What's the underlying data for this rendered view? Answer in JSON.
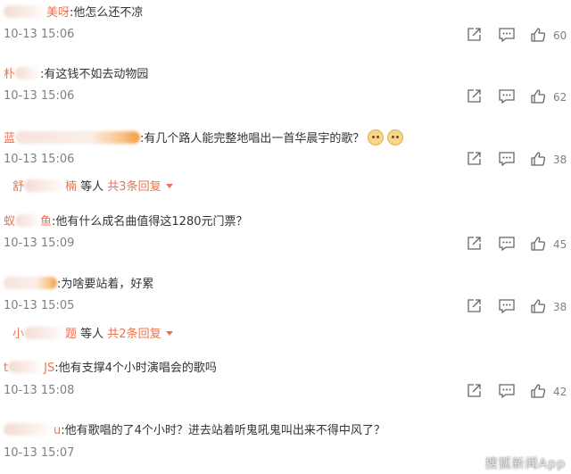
{
  "comments": [
    {
      "name": "美呀",
      "text": ":他怎么还不凉",
      "time": "10-13 15:06",
      "likes": "60"
    },
    {
      "name": "朴",
      "text": ":有这钱不如去动物园",
      "time": "10-13 15:06",
      "likes": "62"
    },
    {
      "name": "蓝",
      "text": ":有几个路人能完整地唱出一首华晨宇的歌？",
      "time": "10-13 15:06",
      "likes": "38"
    },
    {
      "name": "蚁",
      "name2": "鱼",
      "text": ":他有什么成名曲值得这1280元门票？",
      "time": "10-13 15:09",
      "likes": "45"
    },
    {
      "name": "",
      "text": ":为啥要站着，好累",
      "time": "10-13 15:05",
      "likes": "38"
    },
    {
      "name": "t",
      "name2": "JS",
      "text": ":他有支撑4个小时演唱会的歌吗",
      "time": "10-13 15:08",
      "likes": "42"
    },
    {
      "name": "",
      "name2": "u",
      "text": ":他有歌唱的了4个小时？进去站着听鬼吼鬼叫出来不得中风了？",
      "time": "10-13 15:07",
      "likes": ""
    }
  ],
  "replies": [
    {
      "who_start": "舒",
      "who_end": "楠",
      "middle": " 等人 ",
      "more": "共3条回复"
    },
    {
      "who_start": "小",
      "who_end": "题",
      "middle": " 等人 ",
      "more": "共2条回复"
    }
  ],
  "watermark": "搜狐新闻App"
}
